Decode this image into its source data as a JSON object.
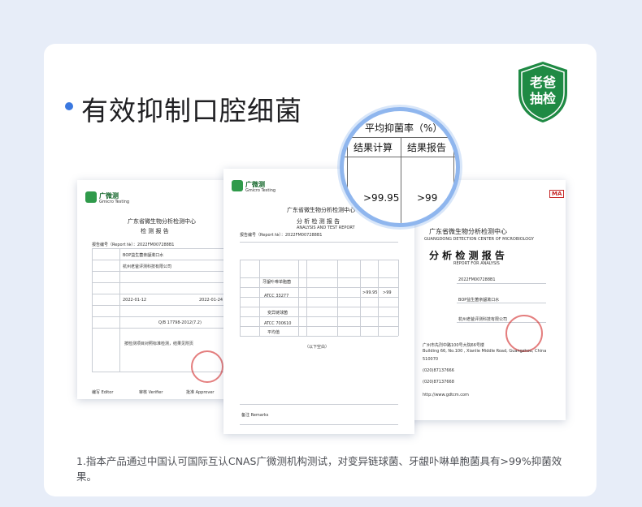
{
  "heading": {
    "title": "有效抑制口腔细菌"
  },
  "badge": {
    "line1": "老爸",
    "line2": "抽检",
    "color": "#1f8a44"
  },
  "magnifier": {
    "header": "平均抑菌率（%）",
    "col1": "结果计算",
    "col2": "结果报告",
    "val1": ">99.95",
    "val2": ">99"
  },
  "doc_left": {
    "logo_name": "广微测",
    "logo_sub": "Gmicro Testing",
    "org": "广东省微生物分析检测中心",
    "report_title": "检 测 报 告",
    "report_no": "报告编号（Report №）：2022FM007288B1",
    "sample": "BOP益生菌亲龈漱口水",
    "client": "杭州老爸评测科技有限公司",
    "standard": "Q/B 17798-2012(7.2)",
    "date1": "2022-01-12",
    "date2": "2022-01-24",
    "conclusion": "按检测项目对照标准检测，结果见附页",
    "sign1": "编写 Editor",
    "sign2": "审核 Verifier",
    "sign3": "批准 Approver"
  },
  "doc_mid": {
    "logo_name": "广微测",
    "logo_sub": "Gmicro Testing",
    "org": "广东省微生物分析检测中心",
    "report_title": "分 析 检 测 报 告",
    "report_sub": "ANALYSIS AND TEST REPORT",
    "report_no": "报告编号（Report №）：2022FM007288B1",
    "strain1": "牙龈卟啉单胞菌",
    "strain1_atcc": "ATCC 33277",
    "strain2": "变异链球菌",
    "strain2_atcc": "ATCC 700610",
    "avg_label": "平均值",
    "result1": ">99.95",
    "result2": ">99",
    "blank": "（以下空白）",
    "remarks": "备注 Remarks"
  },
  "doc_right": {
    "ma": "MA",
    "org": "广东省微生物分析检测中心",
    "org_en": "GUANGDONG DETECTION CENTER OF MICROBIOLOGY",
    "report_title": "分 析 检 测 报 告",
    "report_sub": "REPORT FOR ANALYSIS",
    "report_no": "2022FM007288B1",
    "sample": "BOP益生菌亲龈漱口水",
    "client": "杭州老爸评测科技有限公司",
    "address": "广州市先烈中路100号大院66号楼",
    "address_en": "Building 66, No.100 , Xianlie Middle Road, Guangzhou, China",
    "postcode": "510070",
    "tel": "(020)87137666",
    "fax": "(020)87137668",
    "web": "http://www.gdtcm.com"
  },
  "footnote": "1.指本产品通过中国认可国际互认CNAS广微测机构测试，对变异链球菌、牙龈卟啉单胞菌具有>99%抑菌效果。"
}
